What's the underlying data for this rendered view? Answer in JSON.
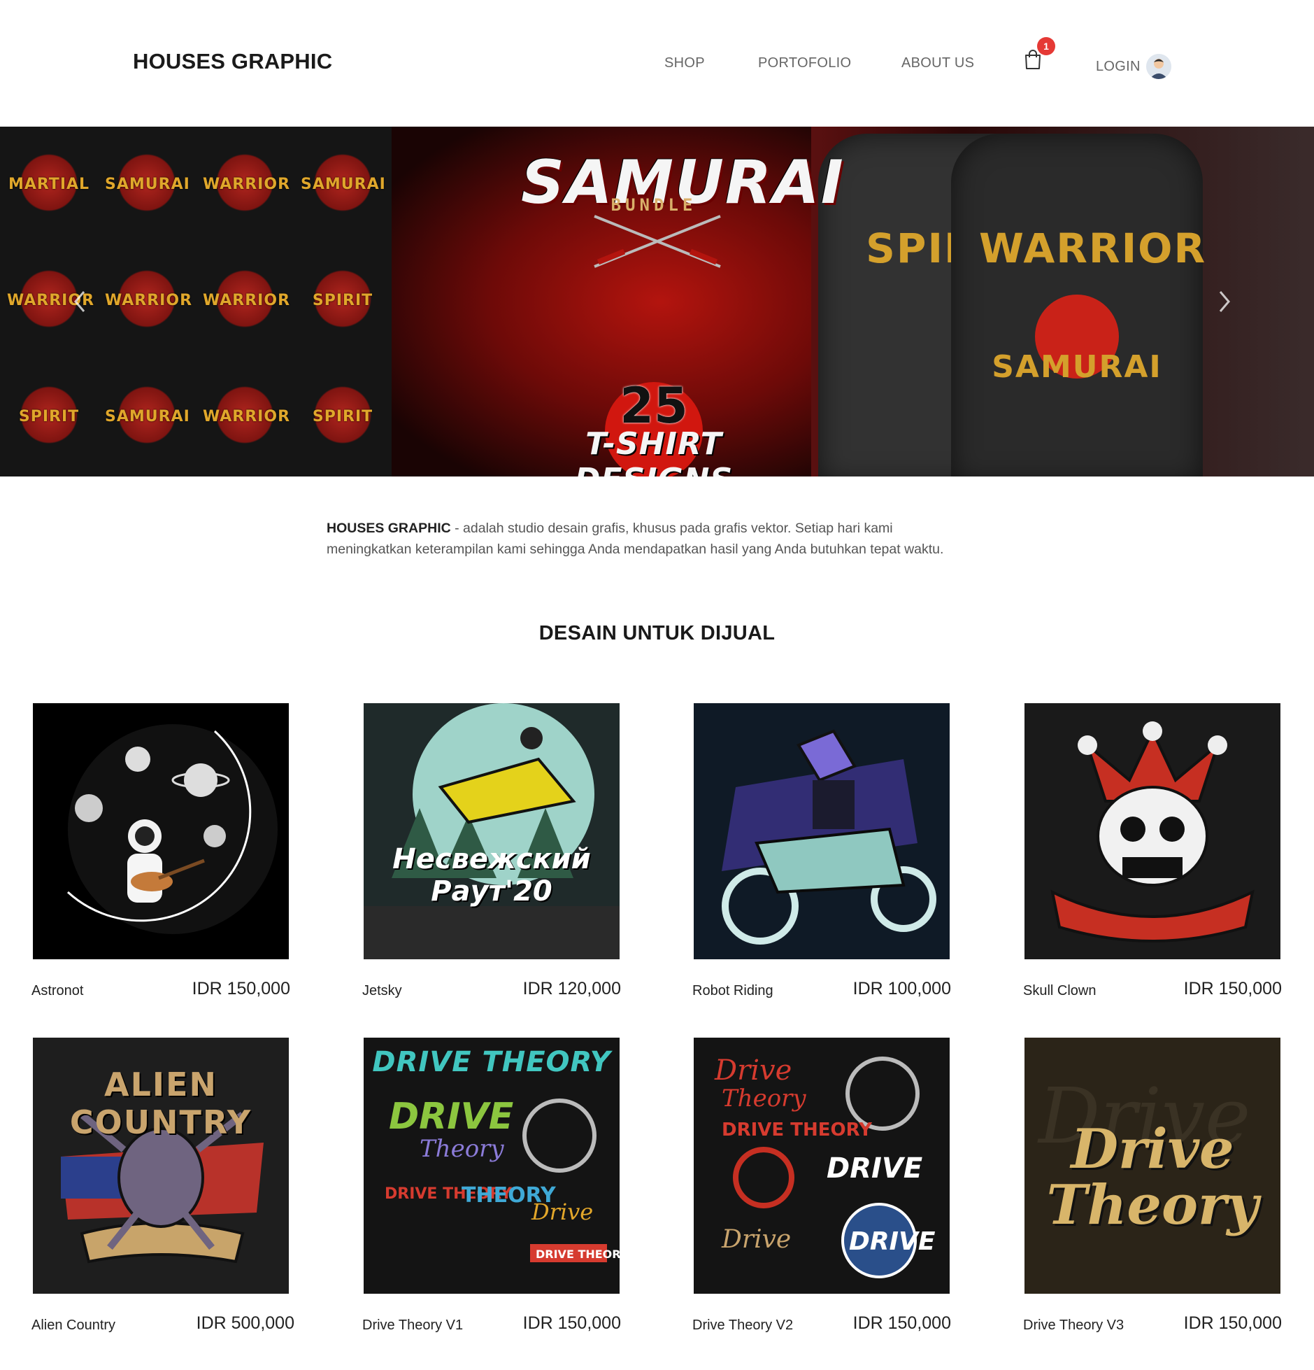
{
  "header": {
    "brand": "HOUSES GRAPHIC",
    "nav": {
      "shop": "SHOP",
      "portofolio": "PORTOFOLIO",
      "about": "ABOUT US"
    },
    "cart_count": "1",
    "login_label": "LOGIN"
  },
  "hero": {
    "title": "SAMURAI",
    "subtitle": "BUNDLE",
    "count": "25",
    "tagline": "T-SHIRT DESIGNS",
    "badges": [
      "MARTIAL",
      "SAMURAI",
      "WARRIOR",
      "SAMURAI",
      "WARRIOR",
      "WARRIOR",
      "WARRIOR",
      "SPIRIT",
      "SPIRIT",
      "SAMURAI",
      "WARRIOR",
      "SPIRIT"
    ],
    "shirt_a": {
      "top": "SPIRIT",
      "bottom": ""
    },
    "shirt_b": {
      "top": "WARRIOR",
      "bottom": "SAMURAI"
    }
  },
  "about": {
    "brand": "HOUSES GRAPHIC",
    "text": " - adalah studio desain grafis, khusus pada grafis vektor. Setiap hari kami meningkatkan keterampilan kami sehingga Anda mendapatkan hasil yang Anda butuhkan tepat waktu."
  },
  "section_title": "DESAIN UNTUK DIJUAL",
  "products": [
    {
      "name": "Astronot",
      "price": "IDR 150,000",
      "bg": "#000000"
    },
    {
      "name": "Jetsky",
      "price": "IDR 120,000",
      "bg": "#1d2b2b"
    },
    {
      "name": "Robot Riding",
      "price": "IDR 100,000",
      "bg": "#0f1a26"
    },
    {
      "name": "Skull Clown",
      "price": "IDR 150,000",
      "bg": "#1a1a1a"
    },
    {
      "name": "Alien Country",
      "price": "IDR 500,000",
      "bg": "#1e1e1e"
    },
    {
      "name": "Drive Theory V1",
      "price": "IDR 150,000",
      "bg": "#141414"
    },
    {
      "name": "Drive Theory V2",
      "price": "IDR 150,000",
      "bg": "#141414"
    },
    {
      "name": "Drive Theory V3",
      "price": "IDR 150,000",
      "bg": "#2b2418"
    }
  ],
  "artwork_text": {
    "jetsky": "Несвежский Раут'20",
    "alien": "ALIEN COUNTRY",
    "drive1": "DRIVE THEORY",
    "drive3": "Drive Theory"
  },
  "colors": {
    "badge": "#e53935",
    "accent_red": "#c2271f",
    "gold": "#d4a02c"
  },
  "icons": {
    "cart": "shopping-bag-icon",
    "avatar": "user-avatar-icon",
    "prev": "chevron-left-icon",
    "next": "chevron-right-icon"
  }
}
